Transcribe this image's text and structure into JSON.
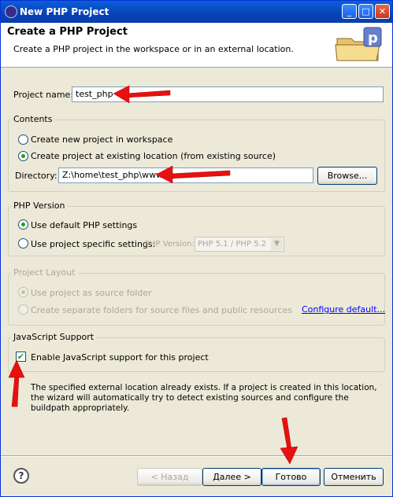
{
  "window": {
    "title": "New PHP Project",
    "minimize_glyph": "_",
    "maximize_glyph": "□",
    "close_glyph": "✕"
  },
  "header": {
    "title": "Create a PHP Project",
    "description": "Create a PHP project in the workspace or in an external location."
  },
  "project_name": {
    "label": "Project name:",
    "value": "test_php"
  },
  "contents": {
    "title": "Contents",
    "option_new": "Create new project in workspace",
    "option_existing": "Create project at existing location (from existing source)",
    "selected": "existing",
    "directory_label": "Directory:",
    "directory_value": "Z:\\home\\test_php\\www",
    "browse_label": "Browse..."
  },
  "php_version": {
    "title": "PHP Version",
    "option_default": "Use default PHP settings",
    "option_specific": "Use project specific settings:",
    "selected": "default",
    "version_label": "PHP Version:",
    "version_value": "PHP 5.1 / PHP 5.2"
  },
  "project_layout": {
    "title": "Project Layout",
    "option_source_folder": "Use project as source folder",
    "option_separate": "Create separate folders for source files and public resources",
    "configure_link": "Configure default..."
  },
  "javascript": {
    "title": "JavaScript Support",
    "enable_label": "Enable JavaScript support for this project",
    "checked": true
  },
  "message": "The specified external location already exists. If a project is created in this location, the wizard will automatically try to detect existing sources and configure the buildpath appropriately.",
  "buttons": {
    "help": "?",
    "back": "< Назад",
    "next": "Далее >",
    "finish": "Готово",
    "cancel": "Отменить"
  },
  "colors": {
    "annotation_arrow": "#e81010",
    "title_bar": "#0842b8"
  },
  "icons": [
    "eclipse-app-icon",
    "php-project-folder-icon",
    "help-icon",
    "check-icon",
    "chevron-down-icon"
  ]
}
